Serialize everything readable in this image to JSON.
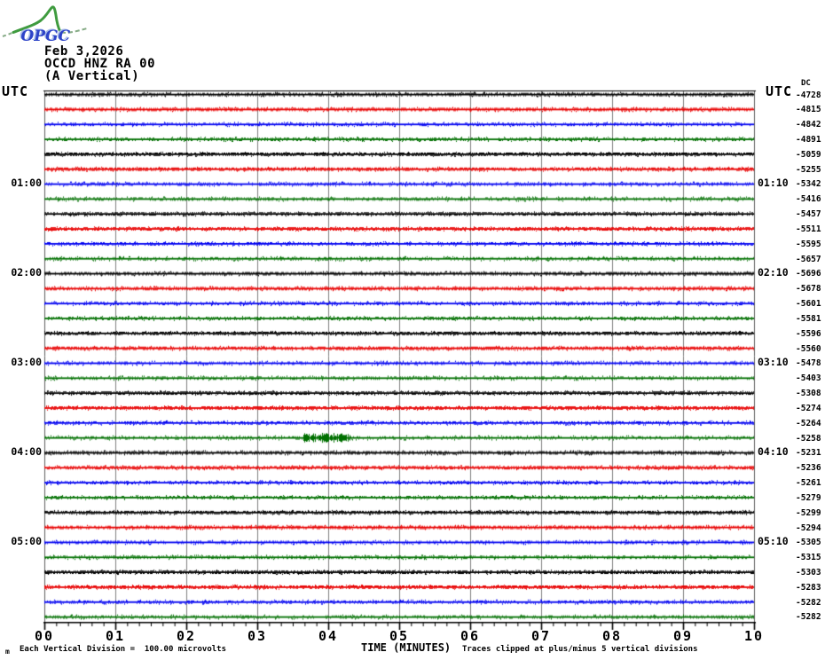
{
  "logo": {
    "text": "OPGC",
    "curve_color": "#3f9b3f",
    "dash_color": "#86ab86",
    "text_color": "#2d43c8",
    "glow_color": "#a8bce8"
  },
  "header": {
    "date": "Feb 3,2026",
    "station": "OCCD HNZ RA 00",
    "component": "(A Vertical)"
  },
  "left_axis_title": "UTC",
  "right_axis_title": "UTC",
  "dc_column_header": "DC",
  "footer": {
    "watermark": "m",
    "scale_note": "Each Vertical Division =  100.00 microvolts",
    "time_axis_title": "TIME (MINUTES)",
    "clip_note": "Traces clipped at plus/minus 5 vertical divisions"
  },
  "chart_data": {
    "type": "line",
    "kind": "helicorder-seismogram",
    "title": "OCCD HNZ RA 00 (A Vertical) — Feb 3,2026",
    "timezone": "UTC",
    "x_axis": {
      "label": "TIME (MINUTES)",
      "range_minutes": [
        0,
        10
      ],
      "major_tick_step_minutes": 1,
      "minor_ticks_per_major": 6,
      "tick_labels": [
        "00",
        "01",
        "02",
        "03",
        "04",
        "05",
        "06",
        "07",
        "08",
        "09",
        "10"
      ]
    },
    "row_duration_minutes": 10,
    "vertical_division_microvolts": 100.0,
    "clip_divisions": 5,
    "grid": {
      "vertical_gridlines_every_minute": true,
      "gridline_color": "#7f7f7f"
    },
    "palette": {
      "black": "#000000",
      "red": "#e80000",
      "blue": "#0000f0",
      "green": "#007000"
    },
    "trace_color_cycle": [
      "black",
      "red",
      "blue",
      "green"
    ],
    "background_signal": "flat traces with low-amplitude background noise, well below one vertical division",
    "events": [
      {
        "row_index": 23,
        "start_minute": 3.65,
        "end_minute": 4.3,
        "amplitude_divisions": 0.25,
        "description": "small high-frequency noise burst on the 03:50 (green) trace"
      }
    ],
    "time_labels": {
      "left": [
        {
          "row": 6,
          "text": "01:00"
        },
        {
          "row": 12,
          "text": "02:00"
        },
        {
          "row": 18,
          "text": "03:00"
        },
        {
          "row": 24,
          "text": "04:00"
        },
        {
          "row": 30,
          "text": "05:00"
        }
      ],
      "right": [
        {
          "row": 6,
          "text": "01:10"
        },
        {
          "row": 12,
          "text": "02:10"
        },
        {
          "row": 18,
          "text": "03:10"
        },
        {
          "row": 24,
          "text": "04:10"
        },
        {
          "row": 30,
          "text": "05:10"
        }
      ]
    },
    "rows": [
      {
        "start": "00:00",
        "end": "00:10",
        "color": "black",
        "dc": -4728
      },
      {
        "start": "00:10",
        "end": "00:20",
        "color": "red",
        "dc": -4815
      },
      {
        "start": "00:20",
        "end": "00:30",
        "color": "blue",
        "dc": -4842
      },
      {
        "start": "00:30",
        "end": "00:40",
        "color": "green",
        "dc": -4891
      },
      {
        "start": "00:40",
        "end": "00:50",
        "color": "black",
        "dc": -5059
      },
      {
        "start": "00:50",
        "end": "01:00",
        "color": "red",
        "dc": -5255
      },
      {
        "start": "01:00",
        "end": "01:10",
        "color": "blue",
        "dc": -5342
      },
      {
        "start": "01:10",
        "end": "01:20",
        "color": "green",
        "dc": -5416
      },
      {
        "start": "01:20",
        "end": "01:30",
        "color": "black",
        "dc": -5457
      },
      {
        "start": "01:30",
        "end": "01:40",
        "color": "red",
        "dc": -5511
      },
      {
        "start": "01:40",
        "end": "01:50",
        "color": "blue",
        "dc": -5595
      },
      {
        "start": "01:50",
        "end": "02:00",
        "color": "green",
        "dc": -5657
      },
      {
        "start": "02:00",
        "end": "02:10",
        "color": "black",
        "dc": -5696
      },
      {
        "start": "02:10",
        "end": "02:20",
        "color": "red",
        "dc": -5678
      },
      {
        "start": "02:20",
        "end": "02:30",
        "color": "blue",
        "dc": -5601
      },
      {
        "start": "02:30",
        "end": "02:40",
        "color": "green",
        "dc": -5581
      },
      {
        "start": "02:40",
        "end": "02:50",
        "color": "black",
        "dc": -5596
      },
      {
        "start": "02:50",
        "end": "03:00",
        "color": "red",
        "dc": -5560
      },
      {
        "start": "03:00",
        "end": "03:10",
        "color": "blue",
        "dc": -5478
      },
      {
        "start": "03:10",
        "end": "03:20",
        "color": "green",
        "dc": -5403
      },
      {
        "start": "03:20",
        "end": "03:30",
        "color": "black",
        "dc": -5308
      },
      {
        "start": "03:30",
        "end": "03:40",
        "color": "red",
        "dc": -5274
      },
      {
        "start": "03:40",
        "end": "03:50",
        "color": "blue",
        "dc": -5264
      },
      {
        "start": "03:50",
        "end": "04:00",
        "color": "green",
        "dc": -5258
      },
      {
        "start": "04:00",
        "end": "04:10",
        "color": "black",
        "dc": -5231
      },
      {
        "start": "04:10",
        "end": "04:20",
        "color": "red",
        "dc": -5236
      },
      {
        "start": "04:20",
        "end": "04:30",
        "color": "blue",
        "dc": -5261
      },
      {
        "start": "04:30",
        "end": "04:40",
        "color": "green",
        "dc": -5279
      },
      {
        "start": "04:40",
        "end": "04:50",
        "color": "black",
        "dc": -5299
      },
      {
        "start": "04:50",
        "end": "05:00",
        "color": "red",
        "dc": -5294
      },
      {
        "start": "05:00",
        "end": "05:10",
        "color": "blue",
        "dc": -5305
      },
      {
        "start": "05:10",
        "end": "05:20",
        "color": "green",
        "dc": -5315
      },
      {
        "start": "05:20",
        "end": "05:30",
        "color": "black",
        "dc": -5303
      },
      {
        "start": "05:30",
        "end": "05:40",
        "color": "red",
        "dc": -5283
      },
      {
        "start": "05:40",
        "end": "05:50",
        "color": "blue",
        "dc": -5282
      },
      {
        "start": "05:50",
        "end": "06:00",
        "color": "green",
        "dc": -5282
      }
    ]
  }
}
